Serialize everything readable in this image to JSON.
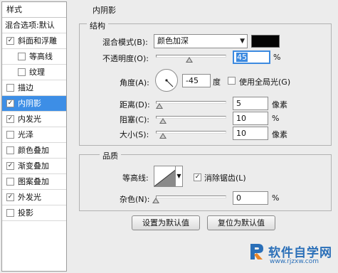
{
  "styles_panel": {
    "header": "样式",
    "blend_options": "混合选项:默认",
    "items": [
      {
        "label": "斜面和浮雕",
        "checked": true,
        "indent": 0,
        "selected": false
      },
      {
        "label": "等高线",
        "checked": false,
        "indent": 1,
        "selected": false
      },
      {
        "label": "纹理",
        "checked": false,
        "indent": 1,
        "selected": false
      },
      {
        "label": "描边",
        "checked": false,
        "indent": 0,
        "selected": false
      },
      {
        "label": "内阴影",
        "checked": true,
        "indent": 0,
        "selected": true
      },
      {
        "label": "内发光",
        "checked": true,
        "indent": 0,
        "selected": false
      },
      {
        "label": "光泽",
        "checked": false,
        "indent": 0,
        "selected": false
      },
      {
        "label": "颜色叠加",
        "checked": false,
        "indent": 0,
        "selected": false
      },
      {
        "label": "渐变叠加",
        "checked": true,
        "indent": 0,
        "selected": false
      },
      {
        "label": "图案叠加",
        "checked": false,
        "indent": 0,
        "selected": false
      },
      {
        "label": "外发光",
        "checked": true,
        "indent": 0,
        "selected": false
      },
      {
        "label": "投影",
        "checked": false,
        "indent": 0,
        "selected": false
      }
    ],
    "check_mark": "✓"
  },
  "inner_shadow": {
    "title": "内阴影",
    "structure": {
      "title": "结构",
      "blend_mode_label": "混合模式(B):",
      "blend_mode_value": "颜色加深",
      "dropdown_arrow": "▼",
      "shadow_color": "#050505",
      "opacity_label": "不透明度(O):",
      "opacity_value": "45",
      "opacity_unit": "%",
      "angle_label": "角度(A):",
      "angle_value": "-45",
      "angle_unit": "度",
      "global_light_label": "使用全局光(G)",
      "global_light_checked": false,
      "distance_label": "距离(D):",
      "distance_value": "5",
      "distance_unit": "像素",
      "choke_label": "阻塞(C):",
      "choke_value": "10",
      "choke_unit": "%",
      "size_label": "大小(S):",
      "size_value": "10",
      "size_unit": "像素"
    },
    "quality": {
      "title": "品质",
      "contour_label": "等高线:",
      "anti_alias_label": "消除锯齿(L)",
      "anti_alias_checked": true,
      "noise_label": "杂色(N):",
      "noise_value": "0",
      "noise_unit": "%"
    },
    "buttons": {
      "make_default": "设置为默认值",
      "reset_default": "复位为默认值"
    }
  },
  "watermark": {
    "text": "软件自学网",
    "url": "www.rjzxw.com",
    "color": "#2a6fb8"
  }
}
